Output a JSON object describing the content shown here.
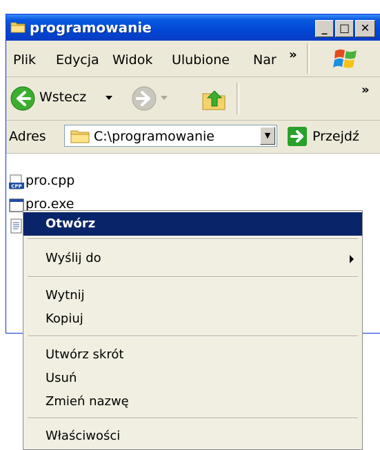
{
  "window": {
    "title": "programowanie",
    "buttons": {
      "minimize": "_",
      "maximize": "□",
      "close": "✕"
    }
  },
  "menubar": {
    "items": [
      "Plik",
      "Edycja",
      "Widok",
      "Ulubione",
      "Nar"
    ],
    "overflow": "»"
  },
  "toolbar": {
    "back_label": "Wstecz",
    "overflow": "»"
  },
  "address": {
    "label": "Adres",
    "value": "C:\\programowanie",
    "go_label": "Przejdź"
  },
  "files": [
    {
      "name": "pro.cpp",
      "icon": "cpp-file-icon"
    },
    {
      "name": "pro.exe",
      "icon": "exe-file-icon"
    },
    {
      "name": "",
      "icon": "text-file-icon",
      "selected": true
    }
  ],
  "context_menu": {
    "open": "Otwórz",
    "send_to": "Wyślij do",
    "cut": "Wytnij",
    "copy": "Kopiuj",
    "create_shortcut": "Utwórz skrót",
    "delete": "Usuń",
    "rename": "Zmień nazwę",
    "properties": "Właściwości"
  },
  "colors": {
    "title_bar": "#0046d5",
    "menu_highlight": "#0a246a",
    "window_bg": "#ece9d8"
  }
}
